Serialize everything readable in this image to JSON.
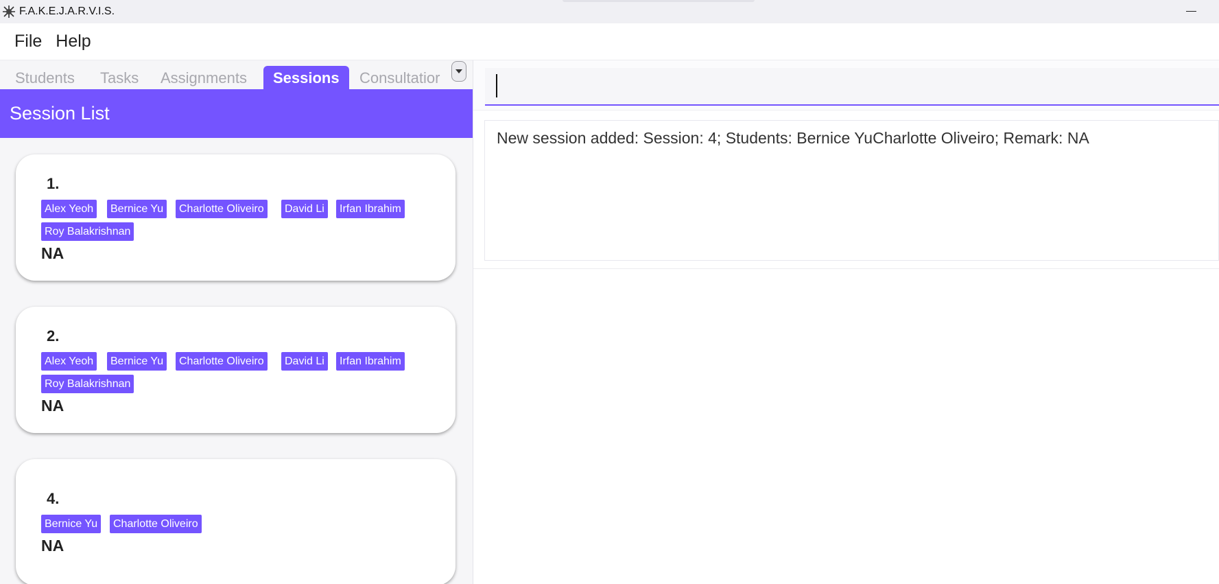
{
  "window": {
    "title": "F.A.K.E.J.A.R.V.I.S.",
    "app_icon": "spider-icon"
  },
  "menu": {
    "items": [
      "File",
      "Help"
    ]
  },
  "tabs": {
    "items": [
      "Students",
      "Tasks",
      "Assignments",
      "Sessions",
      "Consultatior"
    ],
    "active": "Sessions"
  },
  "list": {
    "title": "Session List",
    "sessions": [
      {
        "index": "1.",
        "students": [
          "Alex Yeoh",
          "Bernice Yu",
          "Charlotte Oliveiro",
          "David Li",
          "Irfan Ibrahim",
          "Roy Balakrishnan"
        ],
        "remark": "NA"
      },
      {
        "index": "2.",
        "students": [
          "Alex Yeoh",
          "Bernice Yu",
          "Charlotte Oliveiro",
          "David Li",
          "Irfan Ibrahim",
          "Roy Balakrishnan"
        ],
        "remark": "NA"
      },
      {
        "index": "4.",
        "students": [
          "Bernice Yu",
          "Charlotte Oliveiro"
        ],
        "remark": "NA"
      }
    ]
  },
  "command": {
    "value": ""
  },
  "result": {
    "text": "New session added: Session: 4; Students: Bernice YuCharlotte Oliveiro; Remark: NA"
  },
  "colors": {
    "accent": "#7454ff",
    "panel_bg": "#f6f6f8"
  }
}
